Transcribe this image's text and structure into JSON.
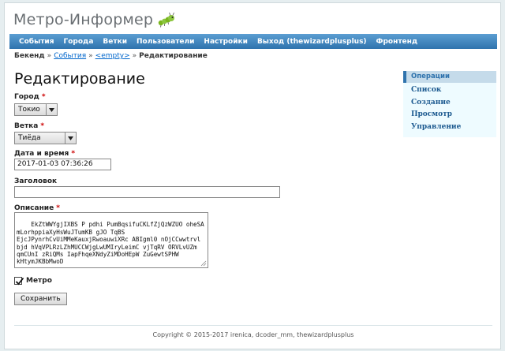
{
  "app": {
    "title": "Метро-Информер"
  },
  "menu": {
    "items": [
      "События",
      "Города",
      "Ветки",
      "Пользователи",
      "Настройки",
      "Выход (thewizardplusplus)",
      "Фронтенд"
    ]
  },
  "breadcrumbs": {
    "root": "Бекенд",
    "sep": "»",
    "items": [
      "События",
      "<empty>"
    ],
    "current": "Редактирование"
  },
  "page": {
    "title": "Редактирование"
  },
  "form": {
    "required_mark": "*",
    "city": {
      "label": "Город",
      "value": "Токио"
    },
    "line": {
      "label": "Ветка",
      "value": "Тиёда"
    },
    "datetime": {
      "label": "Дата и время",
      "value": "2017-01-03 07:36:26"
    },
    "heading": {
      "label": "Заголовок",
      "value": ""
    },
    "description": {
      "label": "Описание",
      "value": "EkZtWWYgjIXBS P pdhi PumBqsifuCKLfZjQzWZUO oheSA W\nmLorhppiaXyHsWuJTumKB gJO TqBS\nEjcJPynrhCvUiMMeKauxjRwoauwiXRc ABIgml0 nOjCCwwtrvl\nbjd hVqVPLRzLZhMUCCWjgLwUMIryLeimC vjTqRV ORVLvUZm\nqmCUnI zRiQMs IapFhqeXNdyZiMDoHEpW ZuGewtSPHW\nkHtymJKBbMwoD"
    },
    "metro": {
      "label": "Метро",
      "checked": true
    },
    "submit_label": "Сохранить"
  },
  "sidebar": {
    "title": "Операции",
    "items": [
      "Список",
      "Создание",
      "Просмотр",
      "Управление"
    ]
  },
  "footer": {
    "text": "Copyright © 2015-2017 irenica, dcoder_mm, thewizardplusplus"
  },
  "colors": {
    "accent": "#2f73ad",
    "link": "#0066cc",
    "required": "#cc0000"
  }
}
